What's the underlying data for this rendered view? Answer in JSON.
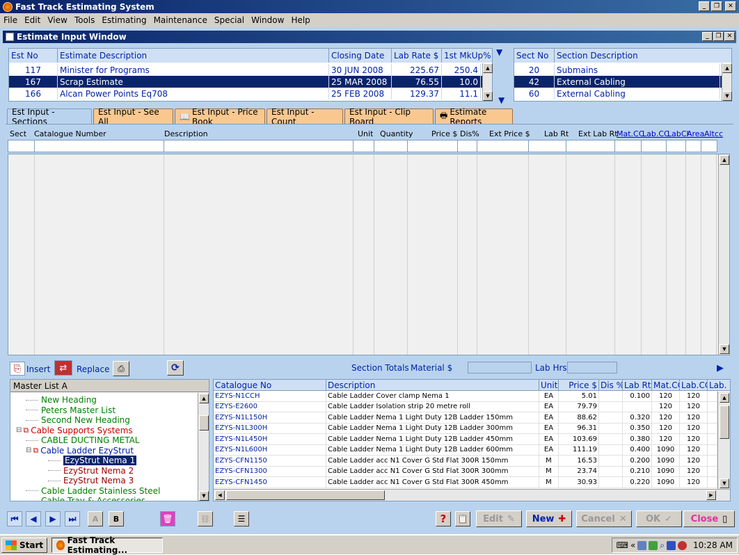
{
  "app_title": "Fast Track Estimating System",
  "menu": [
    "File",
    "Edit",
    "View",
    "Tools",
    "Estimating",
    "Maintenance",
    "Special",
    "Window",
    "Help"
  ],
  "child_title": "Estimate Input Window",
  "estimates": {
    "headers": [
      "Est No",
      "Estimate Description",
      "Closing Date",
      "Lab Rate $",
      "1st MkUp%"
    ],
    "rows": [
      {
        "no": "117",
        "desc": "Minister for Programs",
        "date": "30 JUN 2008",
        "rate": "225.67",
        "mkup": "250.4"
      },
      {
        "no": "167",
        "desc": "Scrap Estimate",
        "date": "25 MAR 2008",
        "rate": "76.55",
        "mkup": "10.0"
      },
      {
        "no": "166",
        "desc": "Alcan Power Points Eq708",
        "date": "25 FEB 2008",
        "rate": "129.37",
        "mkup": "11.1"
      }
    ],
    "selected_index": 1
  },
  "sections": {
    "headers": [
      "Sect No",
      "Section Description"
    ],
    "rows": [
      {
        "no": "20",
        "desc": "Submains"
      },
      {
        "no": "42",
        "desc": "External Cabling"
      },
      {
        "no": "60",
        "desc": "External Cabling"
      }
    ],
    "selected_index": 1
  },
  "tabs": [
    "Est Input - Sections",
    "Est Input - See All",
    "Est Input - Price Book",
    "Est Input - Count",
    "Est Input - Clip Board",
    "Estimate Reports"
  ],
  "input_columns": {
    "sect": "Sect",
    "catalogue": "Catalogue Number",
    "description": "Description",
    "unit": "Unit",
    "quantity": "Quantity",
    "price": "Price $",
    "dis": "Dis%",
    "ext_price": "Ext Price $",
    "lab_rt": "Lab Rt",
    "ext_lab_rt": "Ext Lab Rt",
    "mat_cc": "Mat.CC",
    "lab_cc": "Lab.CC",
    "labcl": "LabCl",
    "area": "Area",
    "altcc": "Altcc"
  },
  "toolbar": {
    "insert": "Insert",
    "replace": "Replace",
    "section_totals": "Section Totals",
    "material": "Material $",
    "lab_hrs": "Lab Hrs"
  },
  "tree": {
    "header": "Master List A",
    "items": [
      {
        "label": "New Heading",
        "color": "green",
        "indent": 2
      },
      {
        "label": "Peters Master List",
        "color": "green",
        "indent": 2
      },
      {
        "label": "Second New Heading",
        "color": "green",
        "indent": 2
      },
      {
        "label": "Cable Supports Systems",
        "color": "red",
        "indent": 1
      },
      {
        "label": "CABLE DUCTING METAL",
        "color": "green",
        "indent": 2
      },
      {
        "label": "Cable Ladder EzyStrut",
        "color": "navy",
        "indent": 2
      },
      {
        "label": "EzyStrut Nema 1",
        "color": "selected",
        "indent": 3
      },
      {
        "label": "EzyStrut Nema 2",
        "color": "dred",
        "indent": 3
      },
      {
        "label": "EzyStrut Nema 3",
        "color": "dred",
        "indent": 3
      },
      {
        "label": "Cable Ladder Stainless Steel",
        "color": "green",
        "indent": 2
      },
      {
        "label": "Cable Tray & Accessories",
        "color": "green",
        "indent": 2
      }
    ]
  },
  "catalogue": {
    "headers": [
      "Catalogue No",
      "Description",
      "Unit",
      "Price $",
      "Dis %",
      "Lab Rt",
      "Mat.CC",
      "Lab.CC",
      "Lab."
    ],
    "rows": [
      [
        "EZYS-N1CCH",
        "Cable Ladder Cover clamp Nema 1",
        "EA",
        "5.01",
        "",
        "0.100",
        "120",
        "120"
      ],
      [
        "EZYS-E2600",
        "Cable Ladder Isolation strip 20 metre roll",
        "EA",
        "79.79",
        "",
        "",
        "120",
        "120"
      ],
      [
        "EZYS-N1L150H",
        "Cable Ladder Nema 1 Light Duty 12B Ladder 150mm",
        "EA",
        "88.62",
        "",
        "0.320",
        "120",
        "120"
      ],
      [
        "EZYS-N1L300H",
        "Cable Ladder Nema 1 Light Duty 12B Ladder 300mm",
        "EA",
        "96.31",
        "",
        "0.350",
        "120",
        "120"
      ],
      [
        "EZYS-N1L450H",
        "Cable Ladder Nema 1 Light Duty 12B Ladder 450mm",
        "EA",
        "103.69",
        "",
        "0.380",
        "120",
        "120"
      ],
      [
        "EZYS-N1L600H",
        "Cable Ladder Nema 1 Light Duty 12B Ladder 600mm",
        "EA",
        "111.19",
        "",
        "0.400",
        "1090",
        "120"
      ],
      [
        "EZYS-CFN1150",
        "Cable Ladder acc N1 Cover G Std Flat 300R 150mm",
        "M",
        "16.53",
        "",
        "0.200",
        "1090",
        "120"
      ],
      [
        "EZYS-CFN1300",
        "Cable Ladder acc N1 Cover G Std Flat 300R 300mm",
        "M",
        "23.74",
        "",
        "0.210",
        "1090",
        "120"
      ],
      [
        "EZYS-CFN1450",
        "Cable Ladder acc N1 Cover G Std Flat 300R 450mm",
        "M",
        "30.93",
        "",
        "0.220",
        "1090",
        "120"
      ]
    ]
  },
  "bottom": {
    "a": "A",
    "b": "B",
    "edit": "Edit",
    "new": "New",
    "cancel": "Cancel",
    "ok": "OK",
    "close": "Close"
  },
  "taskbar": {
    "start": "Start",
    "item": "Fast Track Estimating...",
    "time": "10:28 AM"
  }
}
